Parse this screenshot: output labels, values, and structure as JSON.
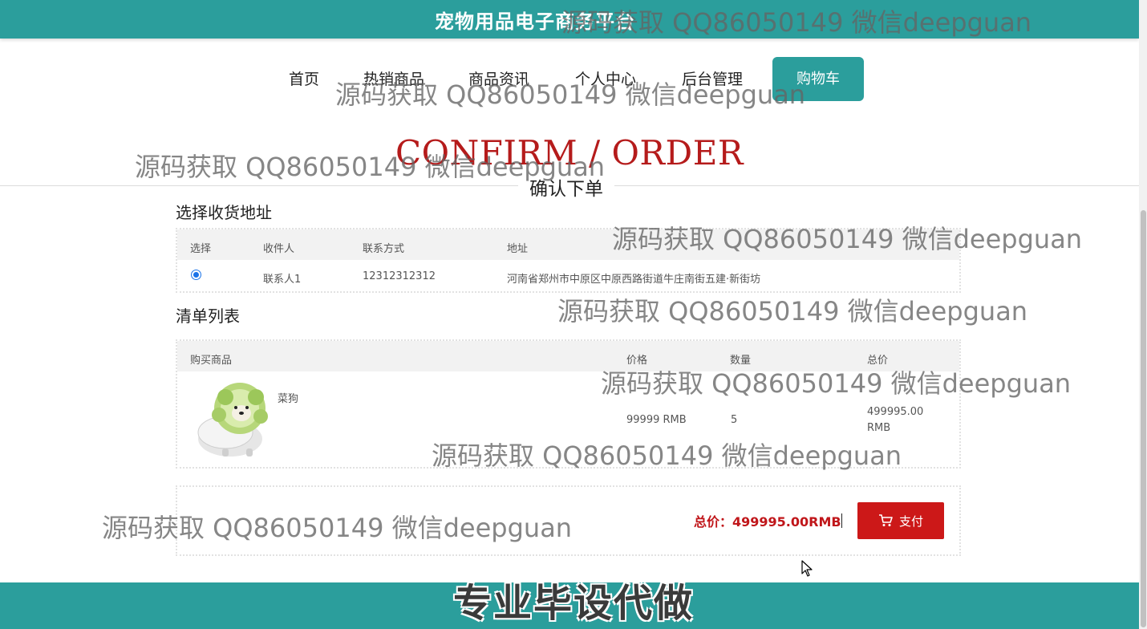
{
  "header": {
    "site_title": "宠物用品电子商务平台"
  },
  "nav": {
    "items": [
      {
        "label": "首页"
      },
      {
        "label": "热销商品"
      },
      {
        "label": "商品资讯"
      },
      {
        "label": "个人中心"
      },
      {
        "label": "后台管理"
      }
    ],
    "cart_label": "购物车"
  },
  "hero": {
    "title_en": "CONFIRM / ORDER",
    "title_cn": "确认下单"
  },
  "address_section": {
    "title": "选择收货地址",
    "columns": [
      "选择",
      "收件人",
      "联系方式",
      "地址"
    ],
    "rows": [
      {
        "selected": true,
        "recipient": "联系人1",
        "phone": "12312312312",
        "address": "河南省郑州市中原区中原西路街道牛庄南街五建·新街坊"
      }
    ]
  },
  "list_section": {
    "title": "清单列表",
    "columns": [
      "购买商品",
      "价格",
      "数量",
      "总价"
    ],
    "items": [
      {
        "name": "菜狗",
        "price": "99999 RMB",
        "quantity": "5",
        "total_line1": "499995.00",
        "total_line2": "RMB"
      }
    ]
  },
  "summary": {
    "total_label": "总价：499995.00RMB",
    "pay_label": "支付"
  },
  "footer": {
    "banner_text": "专业毕设代做"
  },
  "watermark_text": "源码获取 QQ86050149 微信deepguan",
  "colors": {
    "primary": "#2b9e9c",
    "accent_red": "#cc1818",
    "price_red": "#c0161a"
  }
}
